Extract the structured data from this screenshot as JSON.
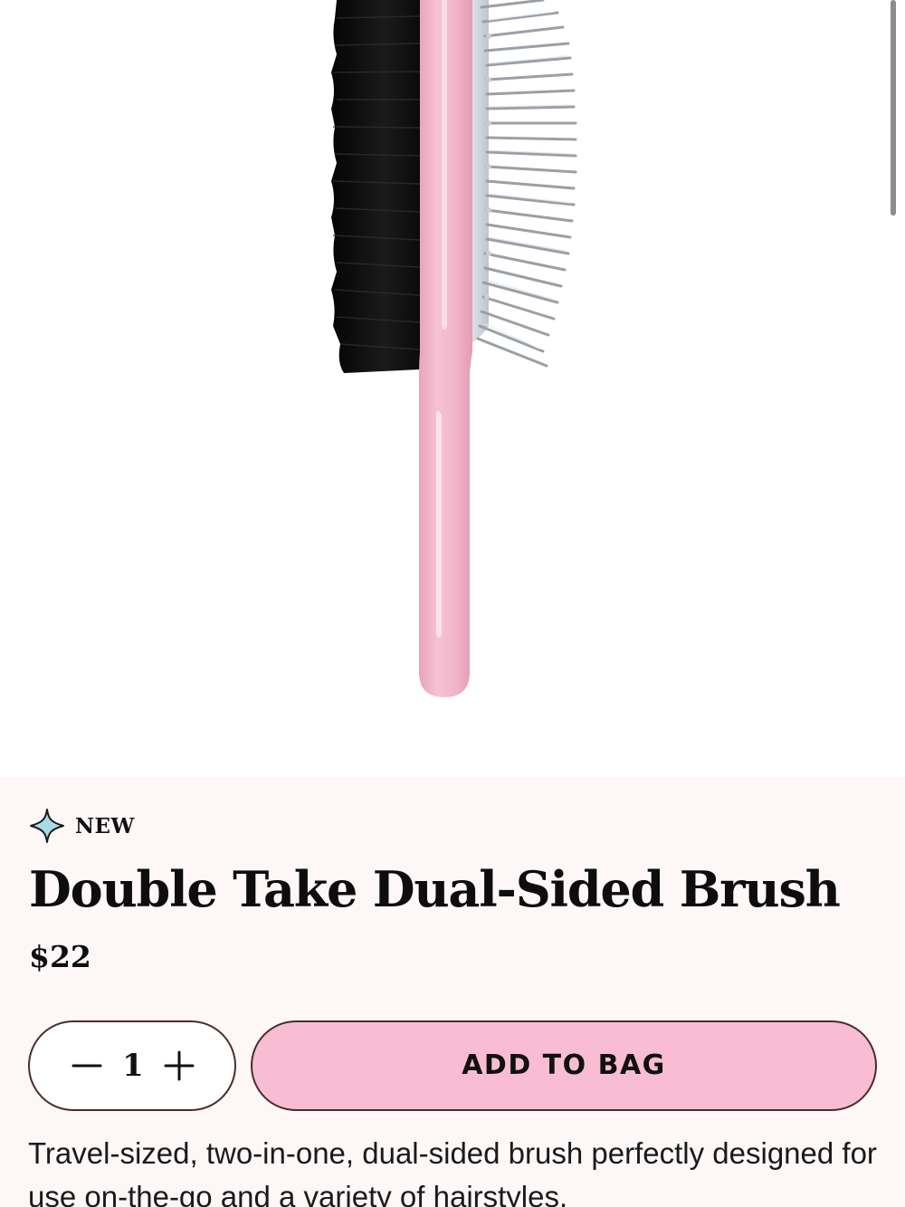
{
  "product": {
    "badge": "NEW",
    "title": "Double Take Dual-Sided Brush",
    "price": "$22",
    "description": "Travel-sized, two-in-one, dual-sided brush perfectly designed for use on-the-go and a variety of hairstyles."
  },
  "quantity": {
    "value": "1",
    "decrement_icon": "minus-icon",
    "increment_icon": "plus-icon"
  },
  "cta": {
    "add_to_bag_label": "ADD TO BAG"
  },
  "icons": {
    "badge_icon": "sparkle-icon"
  },
  "colors": {
    "panel_background": "#fef7f7",
    "button_pink": "#f8bdd3",
    "button_border": "#4a2c2f",
    "brush_handle_pink": "#f2b5c8",
    "sparkle_fill": "#a9dbe6"
  }
}
